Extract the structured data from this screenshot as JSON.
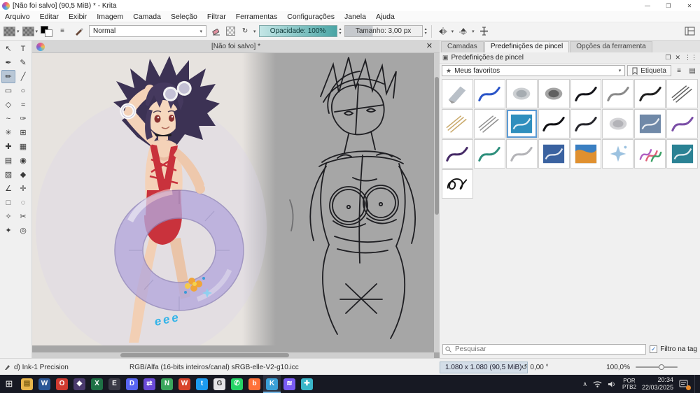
{
  "window": {
    "title": "[Não foi salvo] (90,5 MiB) * - Krita",
    "controls": {
      "min": "—",
      "max": "❐",
      "close": "✕"
    }
  },
  "menubar": {
    "items": [
      {
        "id": "arquivo",
        "label": "Arquivo"
      },
      {
        "id": "editar",
        "label": "Editar"
      },
      {
        "id": "exibir",
        "label": "Exibir"
      },
      {
        "id": "imagem",
        "label": "Imagem"
      },
      {
        "id": "camada",
        "label": "Camada"
      },
      {
        "id": "selecao",
        "label": "Seleção"
      },
      {
        "id": "filtrar",
        "label": "Filtrar"
      },
      {
        "id": "ferramentas",
        "label": "Ferramentas"
      },
      {
        "id": "configuracoes",
        "label": "Configurações"
      },
      {
        "id": "janela",
        "label": "Janela"
      },
      {
        "id": "ajuda",
        "label": "Ajuda"
      }
    ]
  },
  "toolbar": {
    "blend_mode": "Normal",
    "opacity_label": "Opacidade: 100%",
    "size_label": "Tamanho: 3,00 px"
  },
  "toolbox": {
    "tools": [
      {
        "name": "pointer-tool",
        "glyph": "↖"
      },
      {
        "name": "text-tool",
        "glyph": "T"
      },
      {
        "name": "edit-shapes-tool",
        "glyph": "✒"
      },
      {
        "name": "calligraphy-tool",
        "glyph": "✎"
      },
      {
        "name": "freehand-brush-tool",
        "glyph": "✏",
        "selected": true
      },
      {
        "name": "line-tool",
        "glyph": "╱"
      },
      {
        "name": "rectangle-tool",
        "glyph": "▭"
      },
      {
        "name": "ellipse-tool",
        "glyph": "○"
      },
      {
        "name": "polygon-tool",
        "glyph": "◇"
      },
      {
        "name": "polyline-tool",
        "glyph": "≈"
      },
      {
        "name": "bezier-tool",
        "glyph": "~"
      },
      {
        "name": "dynamic-brush-tool",
        "glyph": "✑"
      },
      {
        "name": "multibrush-tool",
        "glyph": "✳"
      },
      {
        "name": "transform-tool",
        "glyph": "⊞"
      },
      {
        "name": "move-tool",
        "glyph": "✚"
      },
      {
        "name": "crop-tool",
        "glyph": "▦"
      },
      {
        "name": "gradient-tool",
        "glyph": "▤"
      },
      {
        "name": "color-sampler-tool",
        "glyph": "◉"
      },
      {
        "name": "pattern-tool",
        "glyph": "▨"
      },
      {
        "name": "fill-tool",
        "glyph": "◆"
      },
      {
        "name": "measure-tool",
        "glyph": "∠"
      },
      {
        "name": "assistants-tool",
        "glyph": "✛"
      },
      {
        "name": "rect-select-tool",
        "glyph": "□"
      },
      {
        "name": "ellipse-select-tool",
        "glyph": "◌"
      },
      {
        "name": "polygon-select-tool",
        "glyph": "✧"
      },
      {
        "name": "freehand-select-tool",
        "glyph": "✂"
      },
      {
        "name": "contiguous-select-tool",
        "glyph": "✦"
      },
      {
        "name": "zoom-tool",
        "glyph": "◎"
      }
    ]
  },
  "canvas": {
    "tab_title": "[Não foi salvo] *",
    "close": "✕",
    "ring_text": "eee"
  },
  "docker": {
    "tabs": [
      {
        "label": "Camadas",
        "active": false
      },
      {
        "label": "Predefinições de pincel",
        "active": true
      },
      {
        "label": "Opções da ferramenta",
        "active": false
      }
    ],
    "header": "Predefinições de pincel",
    "favorites": "Meus favoritos",
    "tag_button": "Etiqueta",
    "search_placeholder": "Pesquisar",
    "filter_tag": "Filtro na tag",
    "brushes": [
      {
        "type": "wedge",
        "c": "#b9c0c8"
      },
      {
        "type": "stroke",
        "c": "#2b55c8"
      },
      {
        "type": "blob",
        "c": "#9aa0a6"
      },
      {
        "type": "blob",
        "c": "#4a4a4a"
      },
      {
        "type": "stroke",
        "c": "#15151a"
      },
      {
        "type": "stroke",
        "c": "#8a8a8a"
      },
      {
        "type": "stroke",
        "c": "#202020"
      },
      {
        "type": "lines",
        "c": "#606060"
      },
      {
        "type": "lines",
        "c": "#c9a96a"
      },
      {
        "type": "lines",
        "c": "#909090"
      },
      {
        "type": "paint",
        "c": "#2f8fbe",
        "selected": true
      },
      {
        "type": "stroke",
        "c": "#101014"
      },
      {
        "type": "stroke",
        "c": "#26262c"
      },
      {
        "type": "blob",
        "c": "#a8a8ae"
      },
      {
        "type": "paint",
        "c": "#7089a8"
      },
      {
        "type": "stroke",
        "c": "#7a4ea6"
      },
      {
        "type": "stroke",
        "c": "#452a66"
      },
      {
        "type": "stroke",
        "c": "#2e8f7c"
      },
      {
        "type": "stroke",
        "c": "#b4b4b8"
      },
      {
        "type": "paint",
        "c": "#3a62a0"
      },
      {
        "type": "paint2",
        "c": "#e0902f",
        "c2": "#3a7fc2"
      },
      {
        "type": "star",
        "c": "#9cc2e0"
      },
      {
        "type": "multi",
        "c": "#b05fc2",
        "c2": "#e0607a",
        "c3": "#3aa065"
      },
      {
        "type": "paint",
        "c": "#2a8294"
      },
      {
        "type": "loops",
        "c": "#141414"
      }
    ]
  },
  "statusbar": {
    "brush_name": "d) Ink-1 Precision",
    "colorspace": "RGB/Alfa (16-bits inteiros/canal)  sRGB-elle-V2-g10.icc",
    "dimensions": "1.080 x 1.080 (90,5 MiB)",
    "angle": "0,00 °",
    "zoom": "100,0%"
  },
  "taskbar": {
    "language_line1": "POR",
    "language_line2": "PTB2",
    "time": "20:34",
    "date": "22/03/2025",
    "apps": [
      {
        "name": "file-explorer-app",
        "bg": "#e8b64c",
        "glyph": "▤",
        "fg": "#7a5b10"
      },
      {
        "name": "word-app",
        "bg": "#2b5797",
        "glyph": "W"
      },
      {
        "name": "opera-browser-app",
        "bg": "#cf3a30",
        "glyph": "O"
      },
      {
        "name": "obsidian-app",
        "bg": "#4a3a6e",
        "glyph": "◆"
      },
      {
        "name": "excel-app",
        "bg": "#1e7145",
        "glyph": "X"
      },
      {
        "name": "epub-reader-app",
        "bg": "#3a3a46",
        "glyph": "E"
      },
      {
        "name": "discord-app",
        "bg": "#5865f2",
        "glyph": "D"
      },
      {
        "name": "purple-arrows-app",
        "bg": "#6a4ad8",
        "glyph": "⇄"
      },
      {
        "name": "green-app",
        "bg": "#3aa55c",
        "glyph": "N"
      },
      {
        "name": "wps-app",
        "bg": "#d9442c",
        "glyph": "W"
      },
      {
        "name": "blue-bird-app",
        "bg": "#1d9bf0",
        "glyph": "t"
      },
      {
        "name": "gray-circle-app",
        "bg": "#e4e4e8",
        "glyph": "G",
        "fg": "#333333"
      },
      {
        "name": "whatsapp-app",
        "bg": "#25d366",
        "glyph": "✆"
      },
      {
        "name": "orange-app",
        "bg": "#ff7139",
        "glyph": "b"
      },
      {
        "name": "krita-app",
        "bg": "#3aa0d8",
        "glyph": "K",
        "selected": true
      },
      {
        "name": "purple-app",
        "bg": "#7a5cf5",
        "glyph": "≋"
      },
      {
        "name": "teal-cross-app",
        "bg": "#3ab6c9",
        "glyph": "✚"
      }
    ]
  },
  "colors": {
    "opacity_slider_accent": "#4aa5a5",
    "selection_blue": "#5b9bd5",
    "swimsuit_red": "#c9323c",
    "hair_purple": "#3c3254",
    "float_ring_lavender": "#b4a8dc",
    "taskbar_dark": "#171923"
  }
}
